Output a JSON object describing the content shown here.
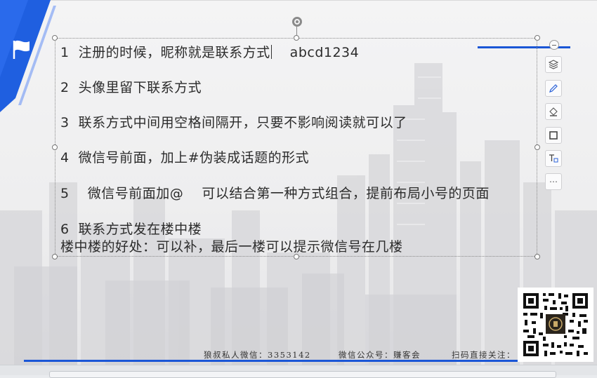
{
  "slide": {
    "lines": [
      "1  注册的时候，昵称就是联系方式",
      "abcd1234",
      "2  头像里留下联系方式",
      "3  联系方式中间用空格间隔开，只要不影响阅读就可以了",
      "4  微信号前面，加上#伪装成话题的形式",
      "5    微信号前面加@    可以结合第一种方式组合，提前布局小号的页面",
      "6  联系方式发在楼中楼",
      "楼中楼的好处：可以补，最后一楼可以提示微信号在几楼"
    ],
    "footer": {
      "wechat": "狼叔私人微信：3353142",
      "official": "微信公众号：赚客会",
      "scan": "扫码直接关注："
    }
  },
  "toolbar": {
    "items": [
      "layers-icon",
      "pen-icon",
      "fill-icon",
      "border-icon",
      "text-format-icon",
      "more-icon"
    ],
    "more_label": "⋯"
  },
  "colors": {
    "accent": "#1a56d6",
    "text": "#2b2b2b"
  }
}
